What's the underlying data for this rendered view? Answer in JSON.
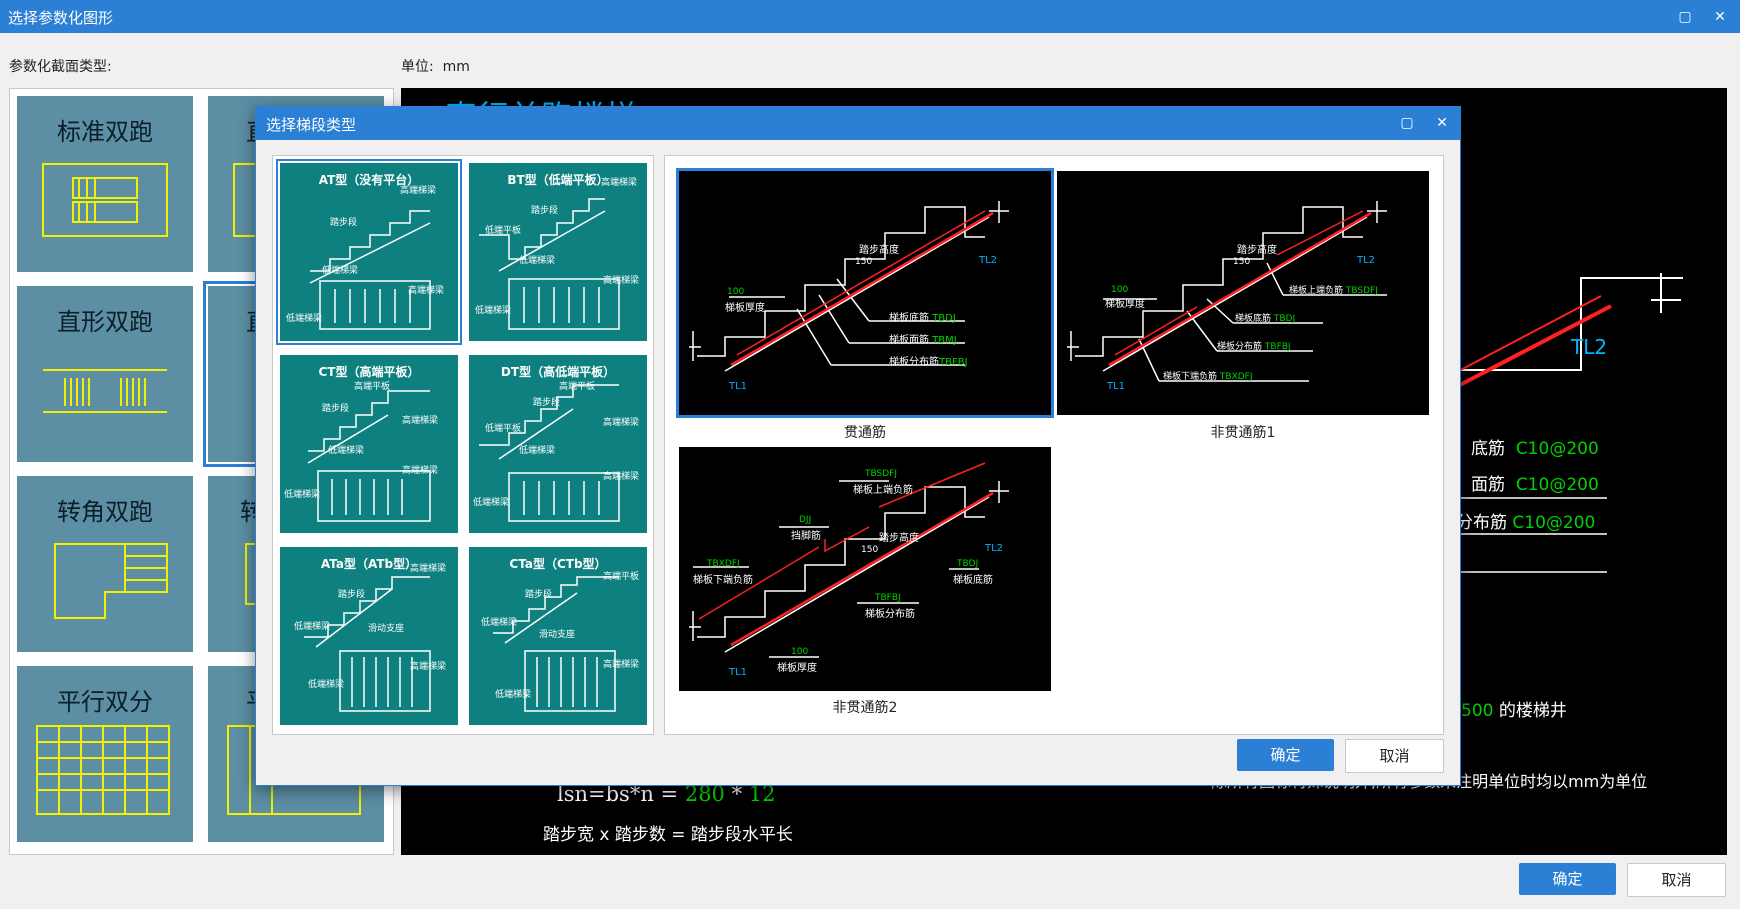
{
  "window": {
    "title": "选择参数化图形",
    "max_icon": "maximize-icon",
    "close_icon": "close-icon"
  },
  "section_label": "参数化截面类型:",
  "unit": {
    "label": "单位:",
    "value": "mm"
  },
  "left_grid": [
    {
      "label": "标准双跑"
    },
    {
      "label": "直"
    },
    {
      "label": "直形双跑"
    },
    {
      "label": "直"
    },
    {
      "label": "转角双跑"
    },
    {
      "label": "转"
    },
    {
      "label": "平行双分"
    },
    {
      "label": "平"
    }
  ],
  "preview": {
    "title_partial": "直行单跑楼梯",
    "tl2": "TL2",
    "rebar_rows": [
      {
        "label": "底筋",
        "value": "C10@200"
      },
      {
        "label": "面筋",
        "value": "C10@200"
      },
      {
        "label": "分布筋",
        "value": "C10@200"
      }
    ],
    "well_value": "500",
    "well_text": "的楼梯井",
    "note": "除所有图标特殊说明外,所有参数未注明单位时均以mm为单位",
    "formula_a": "lsn=bs*n =",
    "formula_v1": "280",
    "formula_star": "*",
    "formula_v2": "12",
    "formula_desc": "踏步宽 x 踏步数 = 踏步段水平长"
  },
  "buttons": {
    "ok": "确定",
    "cancel": "取消"
  },
  "dialog": {
    "title": "选择梯段类型",
    "types": [
      {
        "title": "AT型（没有平台）",
        "labels": [
          "高端梯梁",
          "踏步段",
          "低端梯梁",
          "高端梯梁",
          "低端梯梁"
        ]
      },
      {
        "title": "BT型（低端平板）",
        "labels": [
          "高端梯梁",
          "踏步段",
          "低端平板",
          "低端梯梁",
          "高端梯梁",
          "低端梯梁"
        ]
      },
      {
        "title": "CT型（高端平板）",
        "labels": [
          "高端平板",
          "踏步段",
          "高端梯梁",
          "低端梯梁",
          "高端梯梁",
          "低端梯梁"
        ]
      },
      {
        "title": "DT型（高低端平板）",
        "labels": [
          "高端平板",
          "踏步段",
          "低端平板",
          "高端梯梁",
          "低端梯梁",
          "高端梯梁",
          "低端梯梁"
        ]
      },
      {
        "title": "ATa型（ATb型）",
        "labels": [
          "高端梯梁",
          "踏步段",
          "低端梯梁",
          "滑动支座",
          "高端梯梁",
          "低端梯梁"
        ]
      },
      {
        "title": "CTa型（CTb型）",
        "labels": [
          "高端平板",
          "踏步段",
          "低端梯梁",
          "滑动支座",
          "高端梯梁",
          "低端梯梁"
        ]
      }
    ],
    "reinf": [
      {
        "caption": "贯通筋",
        "labels": {
          "step_h": "踏步高度",
          "dim150": "150",
          "thick": "梯板厚度",
          "dim100": "100",
          "tl1": "TL1",
          "tl2": "TL2"
        },
        "callouts": [
          {
            "text": "梯板底筋",
            "code": "TBDJ"
          },
          {
            "text": "梯板面筋",
            "code": "TBMJ"
          },
          {
            "text": "梯板分布筋",
            "code": "TBFBJ"
          }
        ]
      },
      {
        "caption": "非贯通筋1",
        "labels": {
          "step_h": "踏步高度",
          "dim150": "150",
          "thick": "梯板厚度",
          "dim100": "100",
          "tl1": "TL1",
          "tl2": "TL2"
        },
        "callouts": [
          {
            "text": "梯板上端负筋",
            "code": "TBSDFJ"
          },
          {
            "text": "梯板底筋",
            "code": "TBDJ"
          },
          {
            "text": "梯板分布筋",
            "code": "TBFBJ"
          },
          {
            "text": "梯板下端负筋",
            "code": "TBXDFJ"
          }
        ]
      },
      {
        "caption": "非贯通筋2",
        "labels": {
          "step_h": "踏步高度",
          "dim150": "150",
          "thick": "梯板厚度",
          "dim100": "100",
          "tl1": "TL1",
          "tl2": "TL2"
        },
        "callouts": [
          {
            "code": "TBSDFJ",
            "text": "梯板上端负筋"
          },
          {
            "code": "DJJ",
            "text": "挡脚筋"
          },
          {
            "code": "TBXDFJ",
            "text": "梯板下端负筋"
          },
          {
            "code": "TBDJ",
            "text": "梯板底筋"
          },
          {
            "code": "TBFBJ",
            "text": "梯板分布筋"
          }
        ]
      }
    ]
  },
  "colors": {
    "accent": "#2b7fd4",
    "teal": "#0e8080",
    "preview_bg": "#000000",
    "cad_red": "#ff2020",
    "cad_green": "#00d200",
    "cad_cyan": "#00b4ff"
  }
}
